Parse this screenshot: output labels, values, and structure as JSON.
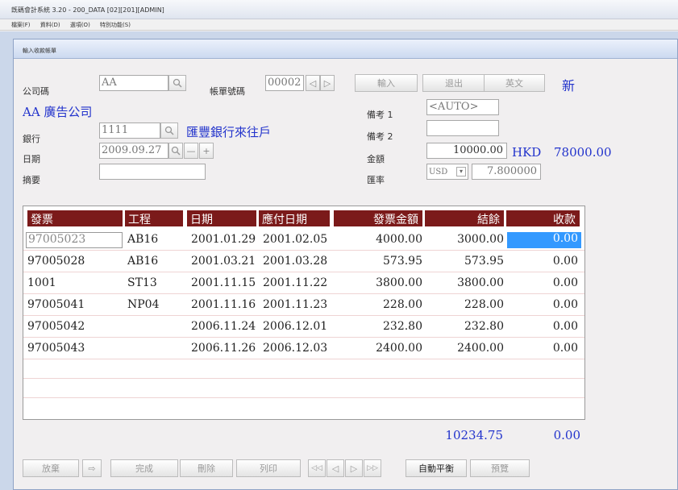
{
  "window": {
    "title": "旣碼會計系統 3.20 - 200_DATA [02][201][ADMIN]",
    "menu": [
      "檔案(F)",
      "資料(D)",
      "選項(O)",
      "特別功能(S)"
    ],
    "child_title": "輸入收款帳單"
  },
  "form": {
    "company_label": "公司碼",
    "company_value": "AA",
    "bill_no_label": "帳單號碼",
    "bill_no_value": "00002",
    "company_name": "AA 廣告公司",
    "bank_label": "銀行",
    "bank_value": "1111",
    "bank_name": "匯豐銀行來往戶",
    "date_label": "日期",
    "date_value": "2009.09.27",
    "summary_label": "摘要",
    "summary_value": "",
    "memo1_label": "備考 1",
    "memo1_value": "<AUTO>",
    "memo2_label": "備考 2",
    "memo2_value": "",
    "amount_label": "金額",
    "amount_value": "10000.00",
    "currency_code": "HKD",
    "amount_local": "78000.00",
    "rate_label": "匯率",
    "rate_currency": "USD",
    "rate_value": "7.800000",
    "new_flag": "新"
  },
  "top_buttons": {
    "input": "輸入",
    "out": "退出",
    "english": "英文"
  },
  "nav": {
    "prev": "◁",
    "next": "▷",
    "minus": "—",
    "plus": "+",
    "dropdown": "▾"
  },
  "grid": {
    "headers": [
      "發票",
      "工程",
      "日期",
      "應付日期",
      "發票金額",
      "結餘",
      "收款"
    ],
    "rows": [
      [
        "97005023",
        "AB16",
        "2001.01.29",
        "2001.02.05",
        "4000.00",
        "3000.00",
        "0.00"
      ],
      [
        "97005028",
        "AB16",
        "2001.03.21",
        "2001.03.28",
        "573.95",
        "573.95",
        "0.00"
      ],
      [
        "1001",
        "ST13",
        "2001.11.15",
        "2001.11.22",
        "3800.00",
        "3800.00",
        "0.00"
      ],
      [
        "97005041",
        "NP04",
        "2001.11.16",
        "2001.11.23",
        "228.00",
        "228.00",
        "0.00"
      ],
      [
        "97005042",
        "",
        "2006.11.24",
        "2006.12.01",
        "232.80",
        "232.80",
        "0.00"
      ],
      [
        "97005043",
        "",
        "2006.11.26",
        "2006.12.03",
        "2400.00",
        "2400.00",
        "0.00"
      ]
    ],
    "total_balance": "10234.75",
    "total_receipt": "0.00"
  },
  "bottom_buttons": {
    "cancel": "放棄",
    "arrow": "⇨",
    "done": "完成",
    "delete": "刪除",
    "print": "列印",
    "first": "◁◁",
    "prev": "◁",
    "next": "▷",
    "last": "▷▷",
    "auto_balance": "自動平衡",
    "preview": "預覽"
  }
}
